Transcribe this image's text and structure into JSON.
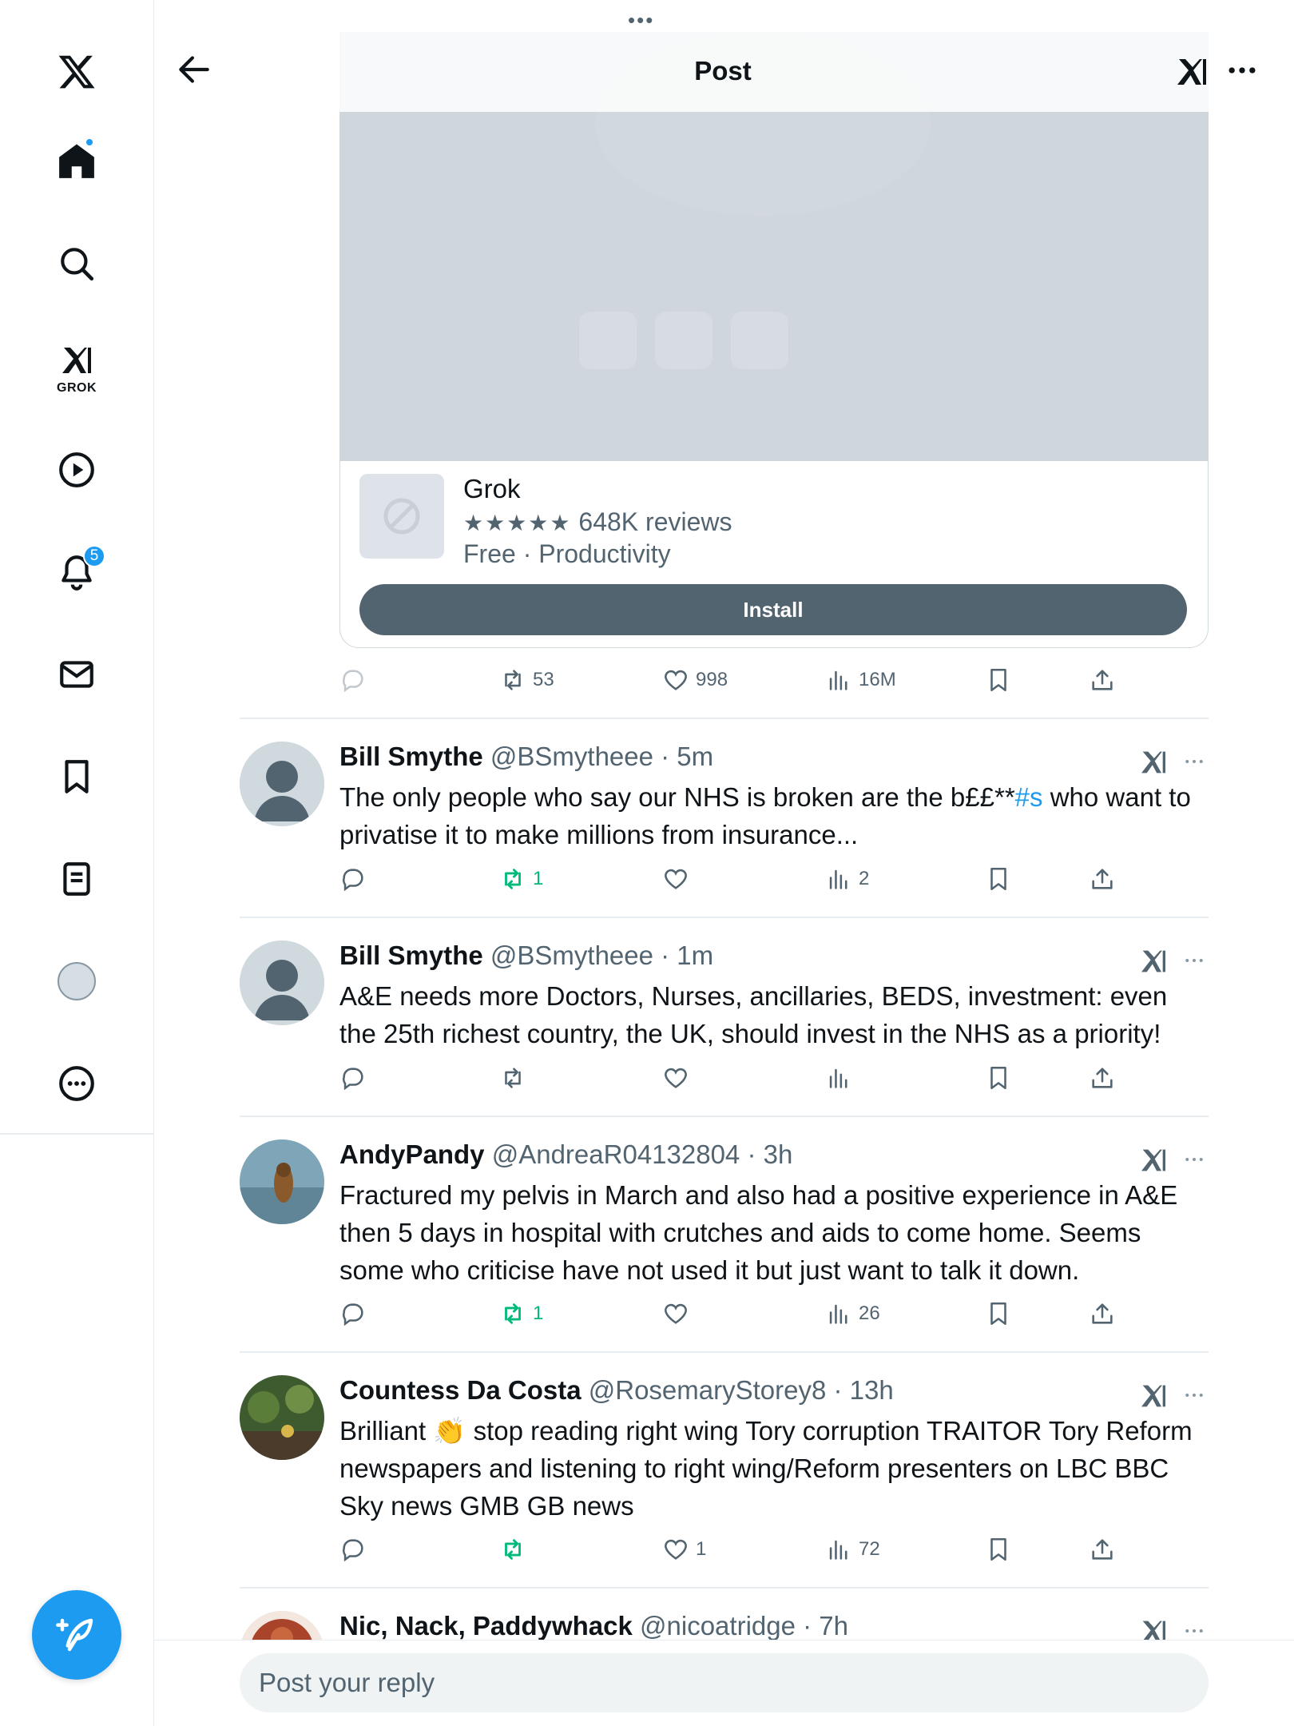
{
  "header": {
    "title": "Post",
    "handle_dots": "•••"
  },
  "sidebar": {
    "grok_label": "GROK",
    "notifications_badge": "5"
  },
  "card": {
    "app_name": "Grok",
    "stars": "★★★★★",
    "reviews": "648K reviews",
    "meta": "Free · Productivity",
    "install_label": "Install"
  },
  "main_post_actions": {
    "reposts": "53",
    "likes": "998",
    "views": "16M"
  },
  "replies": [
    {
      "name": "Bill Smythe",
      "handle": "@BSmytheee · 5m",
      "text_before": "The only people who say our NHS is broken are the b££**",
      "hashtag": "#s",
      "text_after": " who want to privatise it to make millions from insurance...",
      "reposts": "1",
      "likes": "",
      "views": "2"
    },
    {
      "name": "Bill Smythe",
      "handle": "@BSmytheee · 1m",
      "text": "A&E needs more Doctors, Nurses, ancillaries, BEDS, investment: even the 25th richest country, the UK, should invest in the NHS as a priority!",
      "reposts": "",
      "likes": "",
      "views": ""
    },
    {
      "name": "AndyPandy",
      "handle": "@AndreaR04132804 · 3h",
      "text": "Fractured my pelvis in March and also had a positive experience in A&E then 5 days in hospital with crutches and aids to come home. Seems some who criticise have not used it but just want to talk it down.",
      "reposts": "1",
      "likes": "",
      "views": "26"
    },
    {
      "name": "Countess Da Costa",
      "handle": "@RosemaryStorey8 · 13h",
      "text": "Brilliant 👏 stop reading right wing Tory corruption TRAITOR Tory Reform newspapers and listening to right wing/Reform presenters on LBC BBC Sky news GMB GB news",
      "reposts": "",
      "likes": "1",
      "views": "72"
    },
    {
      "name": "Nic, Nack, Paddywhack",
      "handle": "@nicoatridge · 7h"
    }
  ],
  "reply_box": {
    "placeholder": "Post your reply"
  },
  "colors": {
    "accent": "#1d9bf0",
    "repost_active": "#00ba7c",
    "secondary_text": "#536471"
  }
}
